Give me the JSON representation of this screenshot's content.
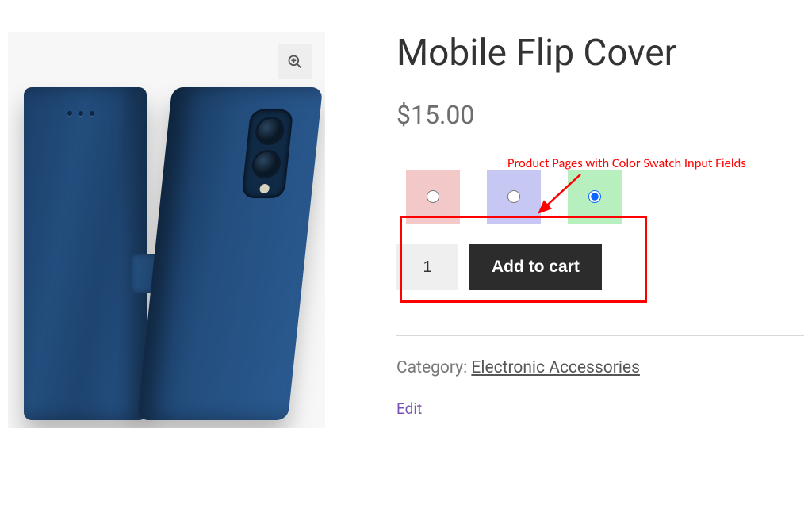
{
  "product": {
    "title": "Mobile Flip Cover",
    "price": "$15.00",
    "quantity": "1",
    "add_to_cart_label": "Add to cart"
  },
  "swatches": [
    {
      "color": "#f3c8c8",
      "selected": false
    },
    {
      "color": "#c6c8f3",
      "selected": false
    },
    {
      "color": "#b7efbf",
      "selected": true
    }
  ],
  "meta": {
    "category_label": "Category: ",
    "category_value": "Electronic Accessories",
    "edit_label": "Edit"
  },
  "annotation": {
    "text": "Product Pages with Color Swatch Input Fields"
  }
}
